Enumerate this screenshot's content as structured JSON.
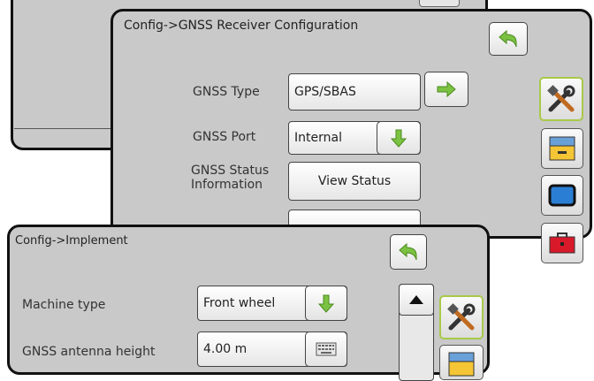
{
  "receiver_panel": {
    "title": "Config->GNSS Receiver Configuration",
    "gnss_type_label": "GNSS Type",
    "gnss_type_value": "GPS/SBAS",
    "gnss_port_label": "GNSS Port",
    "gnss_port_value": "Internal",
    "status_label_line1": "GNSS Status",
    "status_label_line2": "Information",
    "status_button": "View Status"
  },
  "implement_panel": {
    "title": "Config->Implement",
    "machine_type_label": "Machine type",
    "machine_type_value": "Front wheel",
    "antenna_height_label": "GNSS antenna height",
    "antenna_height_value": "4.00 m"
  },
  "side_tabs": [
    "tools-icon",
    "console-icon",
    "screen-icon",
    "toolbox-icon"
  ],
  "colors": {
    "panel": "#c9c9c9",
    "accent_green": "#7cc242",
    "tab_selected": "#a8c94a",
    "toolbox_red": "#d8192a",
    "console_yellow": "#f4c534",
    "screen_blue": "#2a7fd4"
  }
}
